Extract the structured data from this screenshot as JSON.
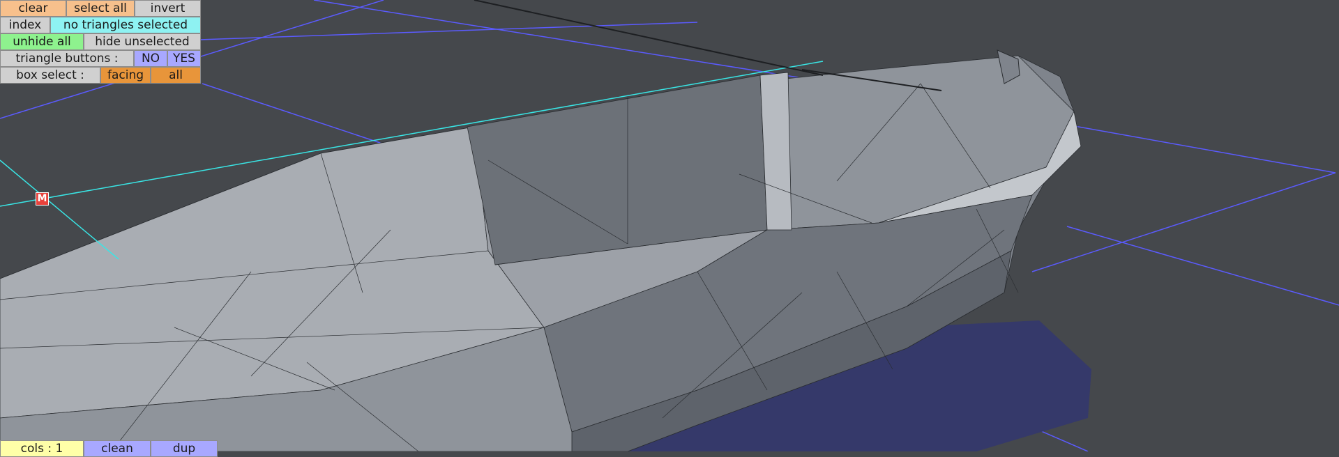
{
  "toolbar": {
    "clear_label": "clear",
    "select_all_label": "select all",
    "invert_label": "invert",
    "index_label": "index",
    "selection_status": "no triangles selected",
    "unhide_all_label": "unhide all",
    "hide_unselected_label": "hide unselected",
    "triangle_buttons_label": "triangle buttons :",
    "no_label": "NO",
    "yes_label": "YES",
    "box_select_label": "box select :",
    "facing_label": "facing",
    "all_label": "all"
  },
  "bottom_bar": {
    "cols_label": "cols : 1",
    "clean_label": "clean",
    "dup_label": "dup"
  },
  "viewport": {
    "marker_label": "M"
  },
  "colors": {
    "background": "#45484c",
    "mesh_light": "#a9adb3",
    "mesh_dark": "#5e636b",
    "grid_line": "#5b5bff",
    "selection_line": "#39e6e6",
    "button_orange": "#f7c08c",
    "button_cyan": "#8ef2f2",
    "button_green": "#8ef28e",
    "button_gray": "#d0d0d0",
    "button_blue": "#a8a8ff",
    "button_dark_orange": "#e8953a",
    "button_yellow": "#ffffa8",
    "marker_red": "#e8423c"
  }
}
